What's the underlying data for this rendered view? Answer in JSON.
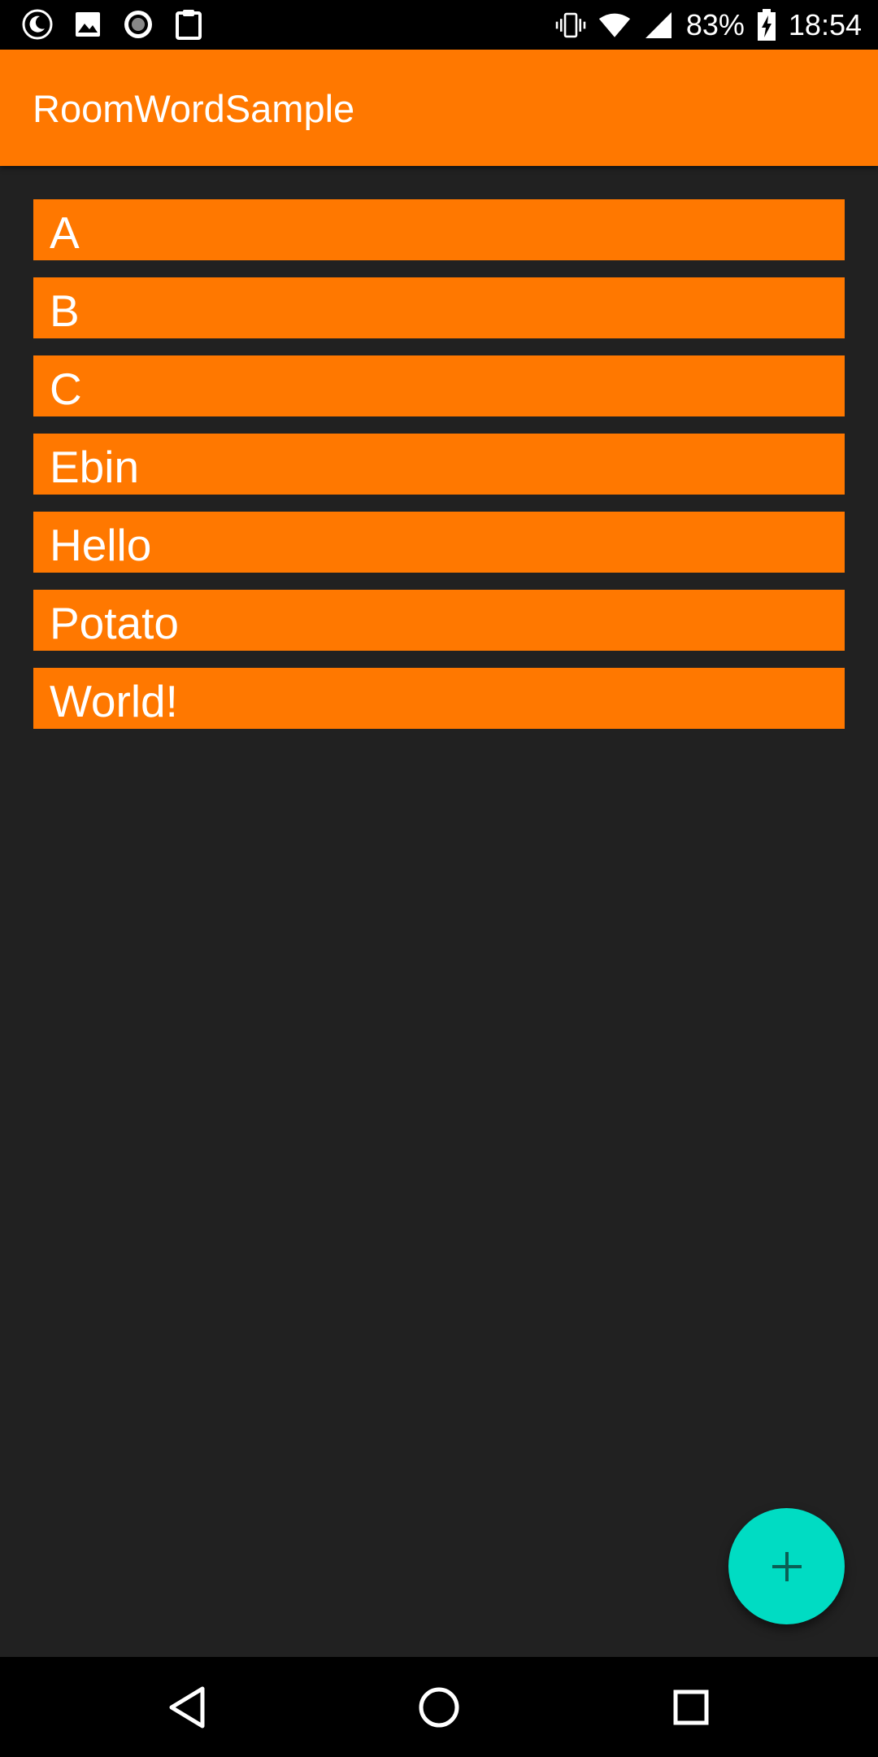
{
  "status_bar": {
    "battery": "83%",
    "time": "18:54",
    "left_icons": [
      "moon-icon",
      "image-icon",
      "record-icon",
      "clipboard-icon"
    ],
    "right_icons": [
      "vibrate-icon",
      "wifi-icon",
      "signal-icon",
      "battery-charging-icon"
    ]
  },
  "app_bar": {
    "title": "RoomWordSample"
  },
  "words": [
    "A",
    "B",
    "C",
    "Ebin",
    "Hello",
    "Potato",
    "World!"
  ],
  "fab": {
    "icon": "plus-icon"
  },
  "nav_bar": {
    "icons": [
      "back-icon",
      "home-icon",
      "recents-icon"
    ]
  },
  "colors": {
    "primary": "#ff7800",
    "background": "#212121",
    "accent": "#00dcc3"
  }
}
